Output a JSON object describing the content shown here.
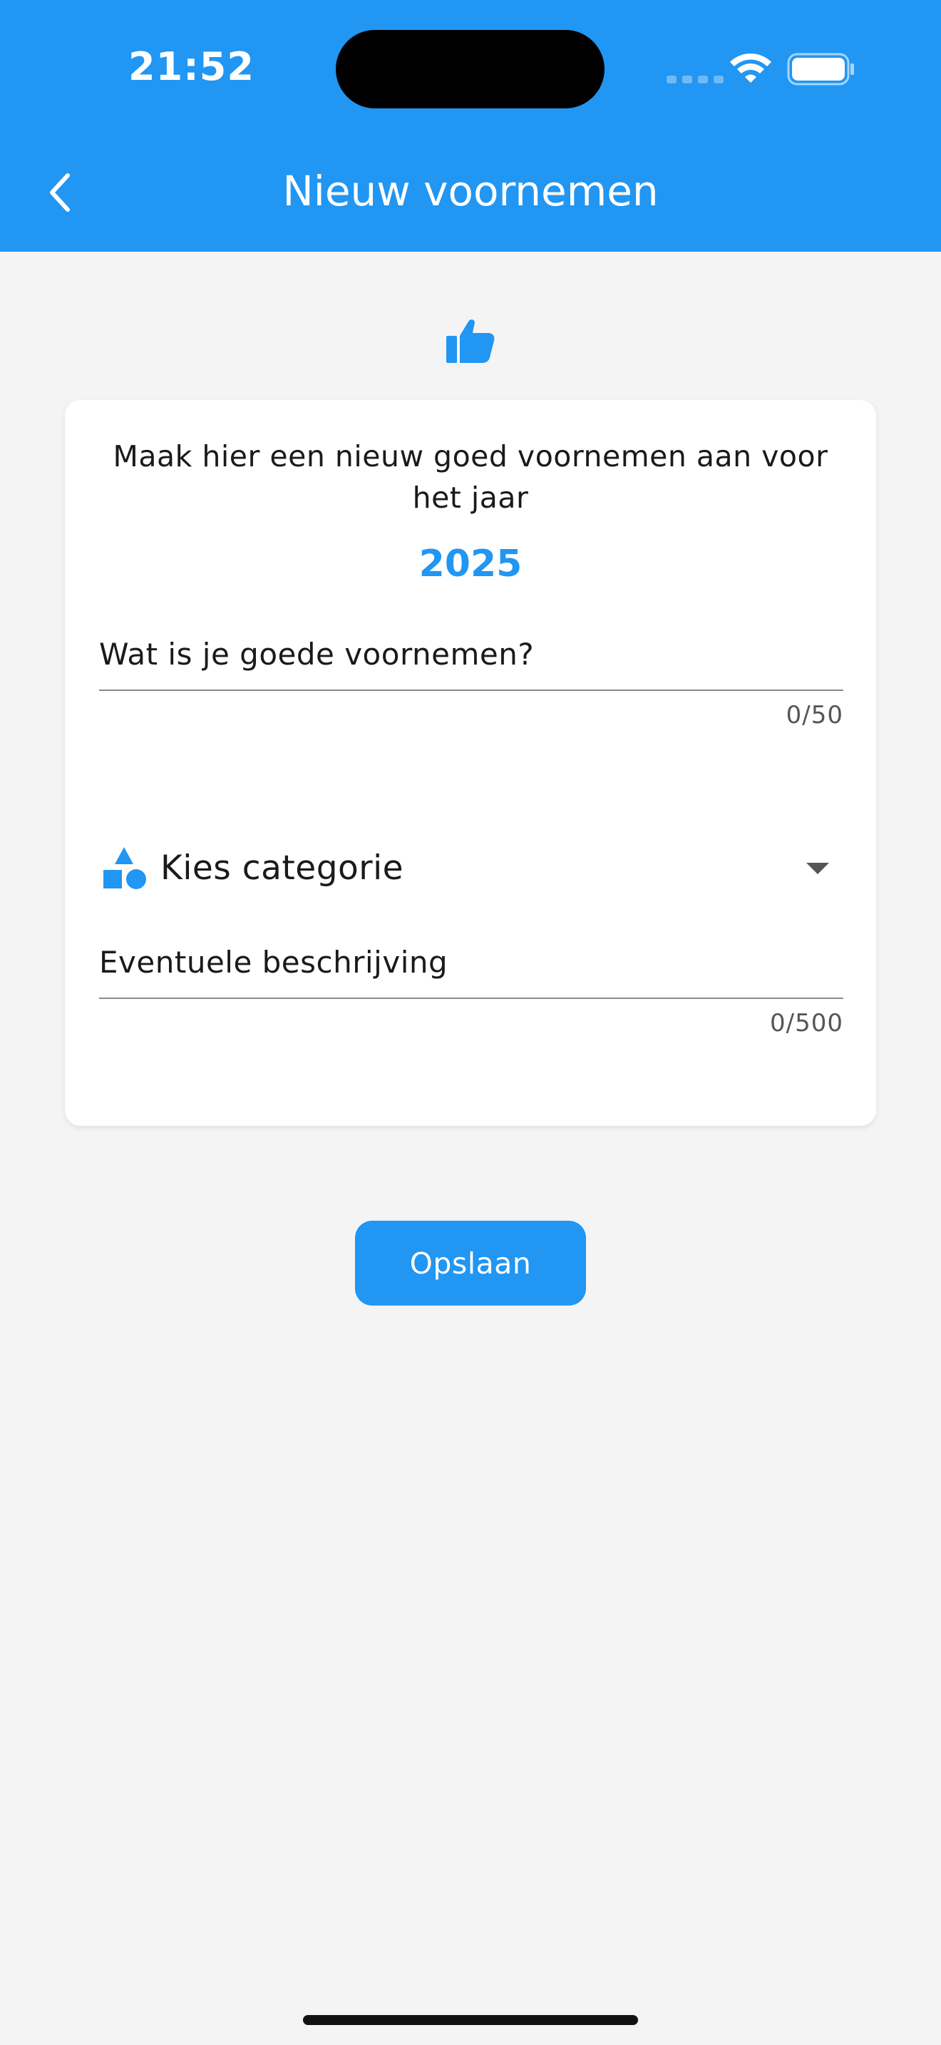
{
  "status_bar": {
    "time": "21:52"
  },
  "header": {
    "title": "Nieuw voornemen",
    "back_icon": "chevron-left-icon",
    "background_color": "#2196f3"
  },
  "hero_icon": "thumbs-up-icon",
  "card": {
    "intro_text": "Maak hier een nieuw goed voornemen aan voor het jaar",
    "year": "2025",
    "title_field": {
      "placeholder": "Wat is je goede voornemen?",
      "value": "",
      "counter": "0/50"
    },
    "category_dropdown": {
      "icon": "category-shapes-icon",
      "label": "Kies categorie"
    },
    "description_field": {
      "placeholder": "Eventuele beschrijving",
      "value": "",
      "counter": "0/500"
    }
  },
  "actions": {
    "save_label": "Opslaan"
  },
  "colors": {
    "accent": "#2196f3",
    "background": "#f4f4f4",
    "card": "#ffffff"
  }
}
